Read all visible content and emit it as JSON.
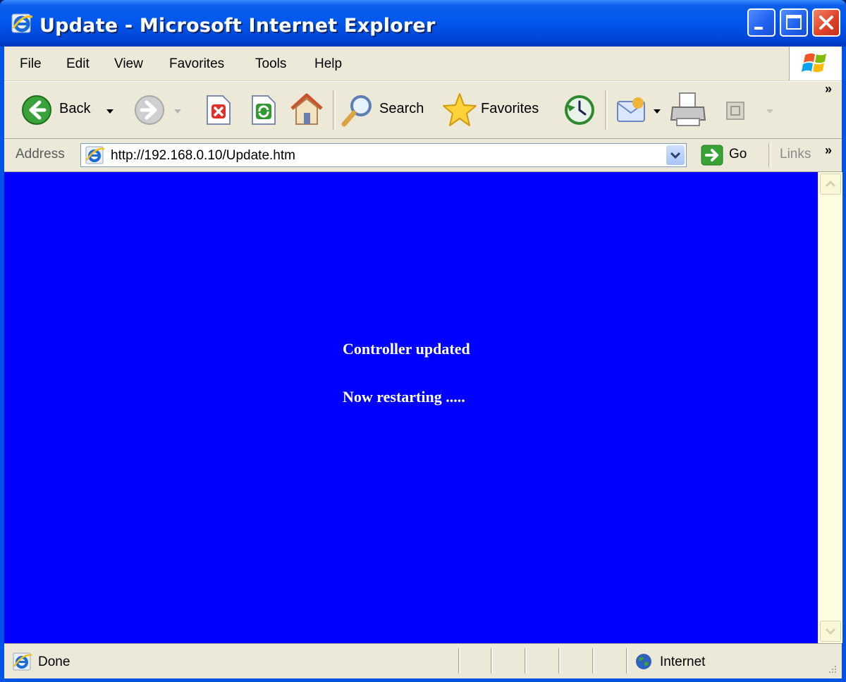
{
  "window": {
    "title": "Update - Microsoft Internet Explorer"
  },
  "menu": {
    "items": [
      "File",
      "Edit",
      "View",
      "Favorites",
      "Tools",
      "Help"
    ]
  },
  "toolbar": {
    "back_label": "Back",
    "search_label": "Search",
    "favorites_label": "Favorites",
    "overflow": "»"
  },
  "address": {
    "label": "Address",
    "url": "http://192.168.0.10/Update.htm",
    "go_label": "Go",
    "links_label": "Links",
    "overflow": "»"
  },
  "page": {
    "line1": "Controller updated",
    "line2": "Now restarting .....",
    "background": "#0000ff"
  },
  "status": {
    "text": "Done",
    "zone": "Internet"
  }
}
